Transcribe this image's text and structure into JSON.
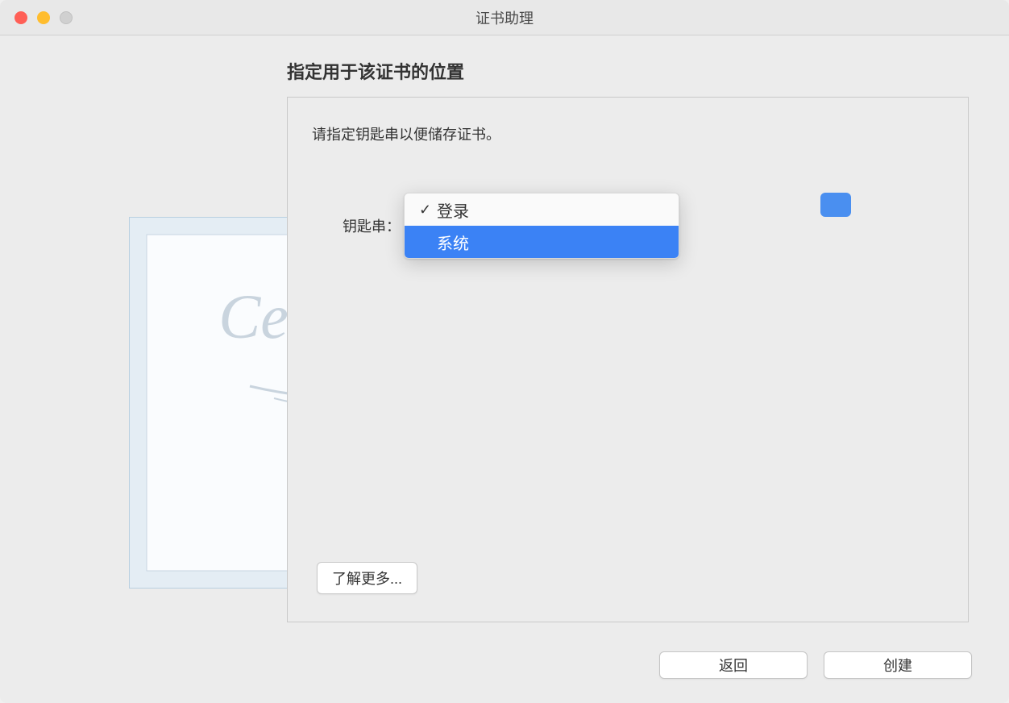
{
  "window": {
    "title": "证书助理"
  },
  "page": {
    "heading": "指定用于该证书的位置",
    "instruction": "请指定钥匙串以便储存证书。"
  },
  "form": {
    "keychain_label": "钥匙串：",
    "dropdown": {
      "options": [
        {
          "label": "登录",
          "selected": true
        },
        {
          "label": "系统",
          "selected": false,
          "highlighted": true
        }
      ],
      "option_login": "登录",
      "option_system": "系统"
    }
  },
  "buttons": {
    "learn_more": "了解更多...",
    "back": "返回",
    "create": "创建"
  }
}
